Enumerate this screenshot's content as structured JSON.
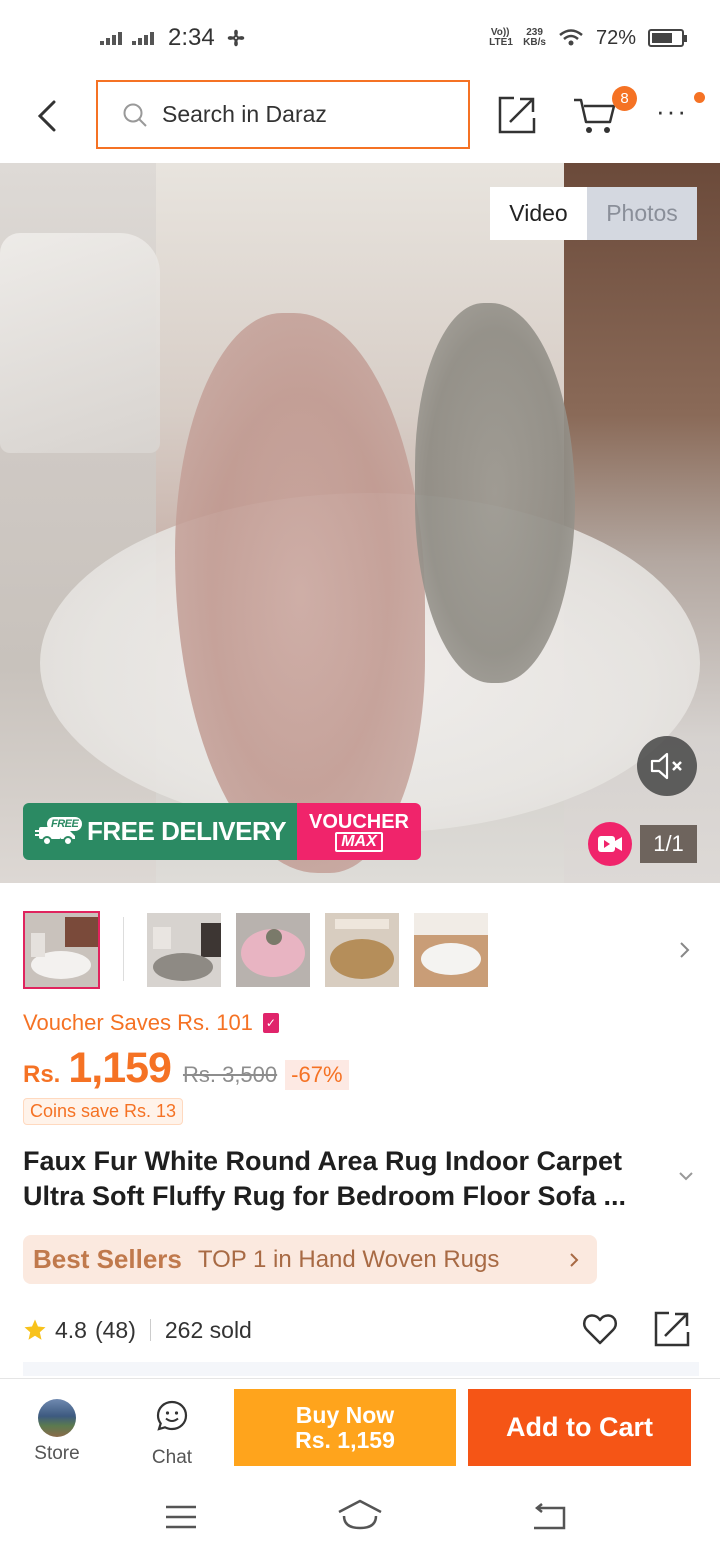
{
  "status_bar": {
    "time": "2:34",
    "network_volte": "Vo)) LTE1",
    "speed_value": "239",
    "speed_unit": "KB/s",
    "battery": "72%",
    "battery_level": 0.72
  },
  "header": {
    "search_placeholder": "Search in Daraz",
    "cart_count": "8",
    "more_label": "···"
  },
  "media": {
    "tab_video": "Video",
    "tab_photos": "Photos",
    "active_tab": "Video",
    "free_badge": "FREE",
    "free_delivery": "FREE DELIVERY",
    "voucher_top": "VOUCHER",
    "voucher_bottom": "MAX",
    "counter": "1/1"
  },
  "thumbnails": [
    {
      "name": "white-round-rug-fireplace",
      "active": true
    },
    {
      "name": "grey-rug-fireplace",
      "active": false
    },
    {
      "name": "pink-round-rug",
      "active": false
    },
    {
      "name": "brown-round-rug",
      "active": false
    },
    {
      "name": "white-rug-floor",
      "active": false
    }
  ],
  "pricing": {
    "voucher_saves": "Voucher Saves Rs. 101",
    "currency": "Rs.",
    "price": "1,159",
    "old_price": "Rs. 3,500",
    "discount": "-67%",
    "coins": "Coins save Rs. 13"
  },
  "product": {
    "title": "Faux Fur White Round Area Rug Indoor Carpet Ultra Soft Fluffy Rug for Bedroom Floor Sofa ..."
  },
  "best_sellers": {
    "brand": "Best Sellers",
    "text": "TOP 1 in Hand Woven Rugs"
  },
  "rating": {
    "score": "4.8",
    "count": "(48)",
    "sold": "262 sold"
  },
  "bottom_bar": {
    "store_label": "Store",
    "chat_label": "Chat",
    "buy_now_label": "Buy Now",
    "buy_now_price": "Rs. 1,159",
    "add_to_cart_label": "Add to Cart"
  },
  "colors": {
    "brand_orange": "#f57224",
    "buy_now": "#ffa41c",
    "add_to_cart": "#f55516",
    "free_delivery_green": "#2b8a63",
    "voucher_pink": "#f0246b"
  }
}
